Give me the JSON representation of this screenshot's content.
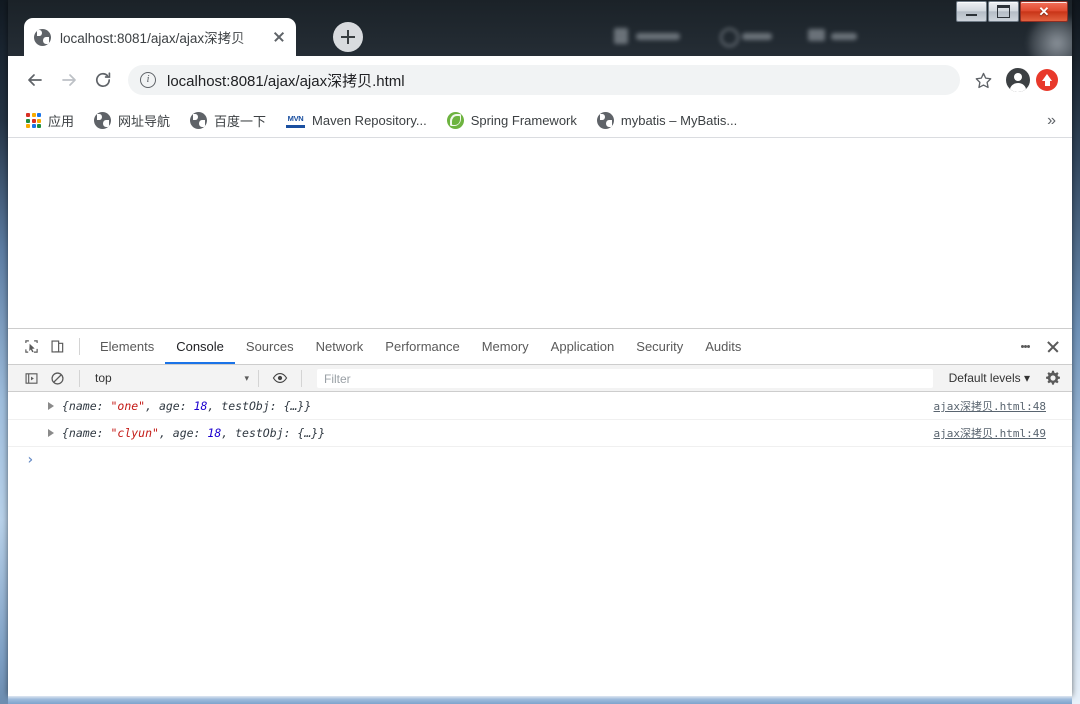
{
  "window": {
    "controls": {
      "minimize_label": "–",
      "maximize_label": "",
      "close_label": "✕"
    }
  },
  "tabs": [
    {
      "title": "localhost:8081/ajax/ajax深拷贝",
      "favicon": "globe-icon",
      "active": true
    }
  ],
  "new_tab": {
    "label": "+"
  },
  "toolbar": {
    "back_label": "←",
    "forward_label": "→",
    "reload_label": "↻",
    "url": "localhost:8081/ajax/ajax深拷贝.html",
    "security_icon": "info-icon",
    "star_icon": "star-icon",
    "avatar_icon": "profile-avatar-icon",
    "extension_icon": "extension-icon"
  },
  "bookmarks": {
    "apps_label": "应用",
    "items": [
      {
        "label": "网址导航",
        "icon": "globe-icon"
      },
      {
        "label": "百度一下",
        "icon": "globe-icon"
      },
      {
        "label": "Maven Repository...",
        "icon": "mvn-icon"
      },
      {
        "label": "Spring Framework",
        "icon": "spring-icon"
      },
      {
        "label": "mybatis – MyBatis...",
        "icon": "globe-icon"
      }
    ],
    "overflow_label": "»"
  },
  "devtools": {
    "tabs": [
      {
        "label": "Elements",
        "active": false
      },
      {
        "label": "Console",
        "active": true
      },
      {
        "label": "Sources",
        "active": false
      },
      {
        "label": "Network",
        "active": false
      },
      {
        "label": "Performance",
        "active": false
      },
      {
        "label": "Memory",
        "active": false
      },
      {
        "label": "Application",
        "active": false
      },
      {
        "label": "Security",
        "active": false
      },
      {
        "label": "Audits",
        "active": false
      }
    ],
    "inspect_icon": "inspect-element-icon",
    "device_icon": "device-toolbar-icon",
    "more_label": "⋮",
    "close_label": "✕",
    "console_bar": {
      "execute_icon": "execution-context-icon",
      "clear_icon": "clear-console-icon",
      "context_value": "top",
      "context_caret": "▾",
      "eye_icon": "live-expression-icon",
      "filter_placeholder": "Filter",
      "filter_value": "",
      "levels_value": "Default levels",
      "levels_caret": "▾",
      "settings_icon": "gear-icon"
    },
    "messages": [
      {
        "expand_icon": "expand-triangle-icon",
        "prefix": "{name: ",
        "string_value": "\"one\"",
        "mid": ", age: ",
        "number_value": "18",
        "suffix": ", testObj: {…}}",
        "source": "ajax深拷贝.html:48"
      },
      {
        "expand_icon": "expand-triangle-icon",
        "prefix": "{name: ",
        "string_value": "\"clyun\"",
        "mid": ", age: ",
        "number_value": "18",
        "suffix": ", testObj: {…}}",
        "source": "ajax深拷贝.html:49"
      }
    ],
    "prompt_caret": "›"
  },
  "colors": {
    "accent": "#1a73e8",
    "console_string": "#c41a16",
    "console_number": "#1c00cf",
    "close_button": "#e04b30",
    "extension": "#e8392b",
    "spring_green": "#6db33f"
  }
}
